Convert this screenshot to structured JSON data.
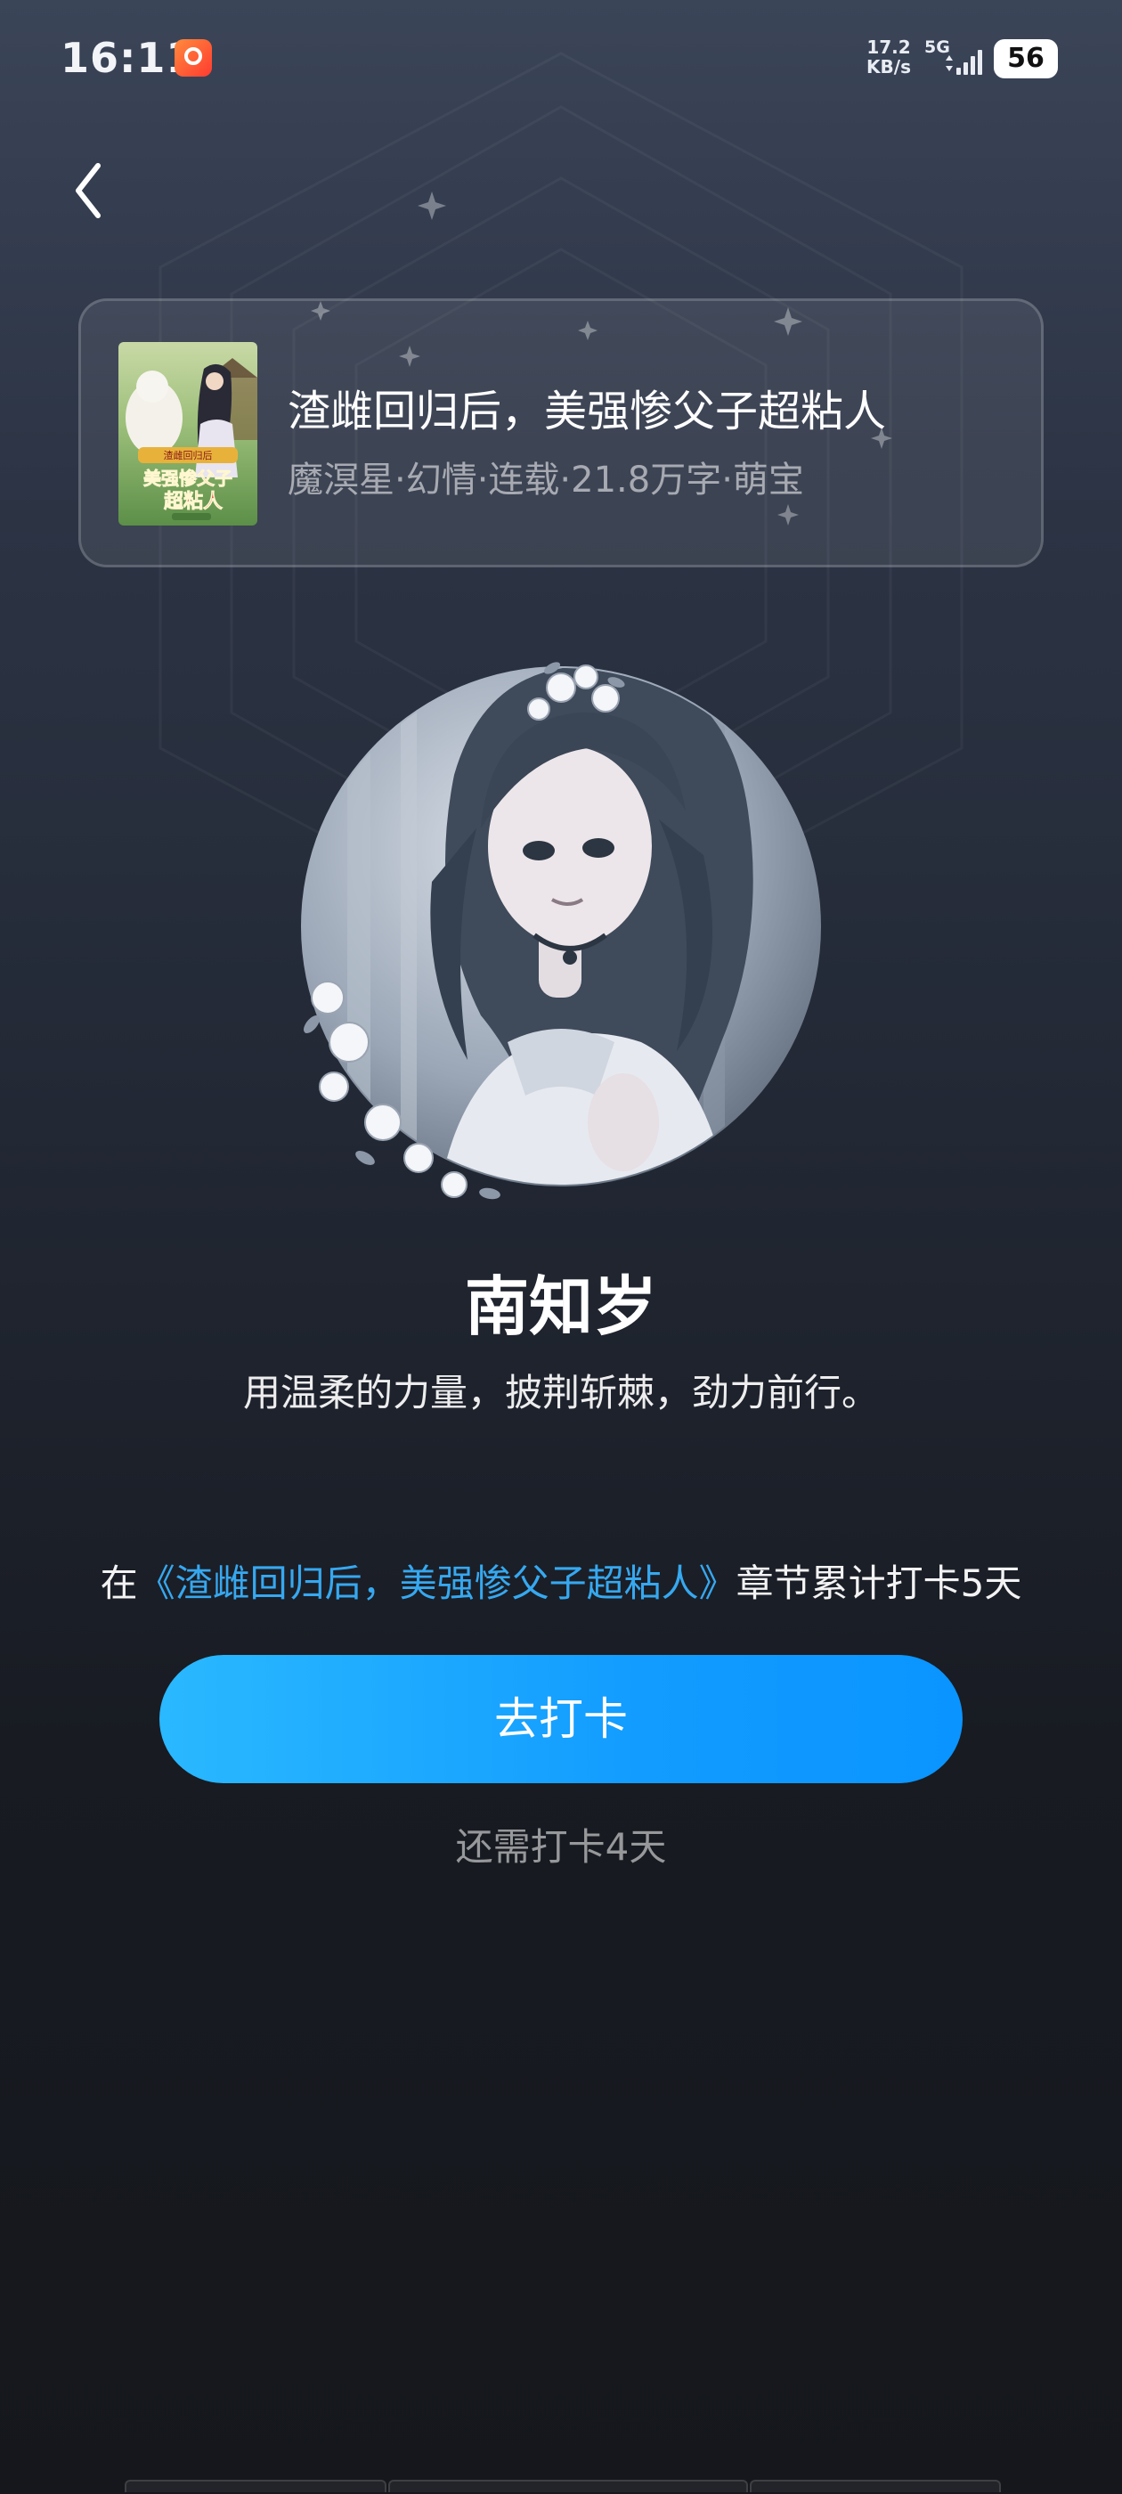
{
  "status_bar": {
    "time": "16:11",
    "speed_value": "17.2",
    "speed_unit": "KB/s",
    "network": "5G",
    "battery": "56"
  },
  "book": {
    "title": "渣雌回归后，美强惨父子超粘人",
    "meta": "魔溟星·幻情·连载·21.8万字·萌宝",
    "cover_text": "美强惨父子超粘人"
  },
  "character": {
    "name": "南知岁",
    "motto": "用温柔的力量，披荆斩棘，劲力前行。"
  },
  "checkin": {
    "prefix": "在",
    "book_link": "《渣雌回归后，美强惨父子超粘人》",
    "suffix": "章节累计打卡5天",
    "button_label": "去打卡",
    "remaining": "还需打卡4天"
  },
  "colors": {
    "accent": "#1aa3ff",
    "link": "#36a8f0",
    "background_top": "#3b4558",
    "background_bottom": "#15171c"
  },
  "icons": {
    "back": "chevron-left-icon",
    "app": "app-notification-icon",
    "signal": "signal-icon"
  }
}
